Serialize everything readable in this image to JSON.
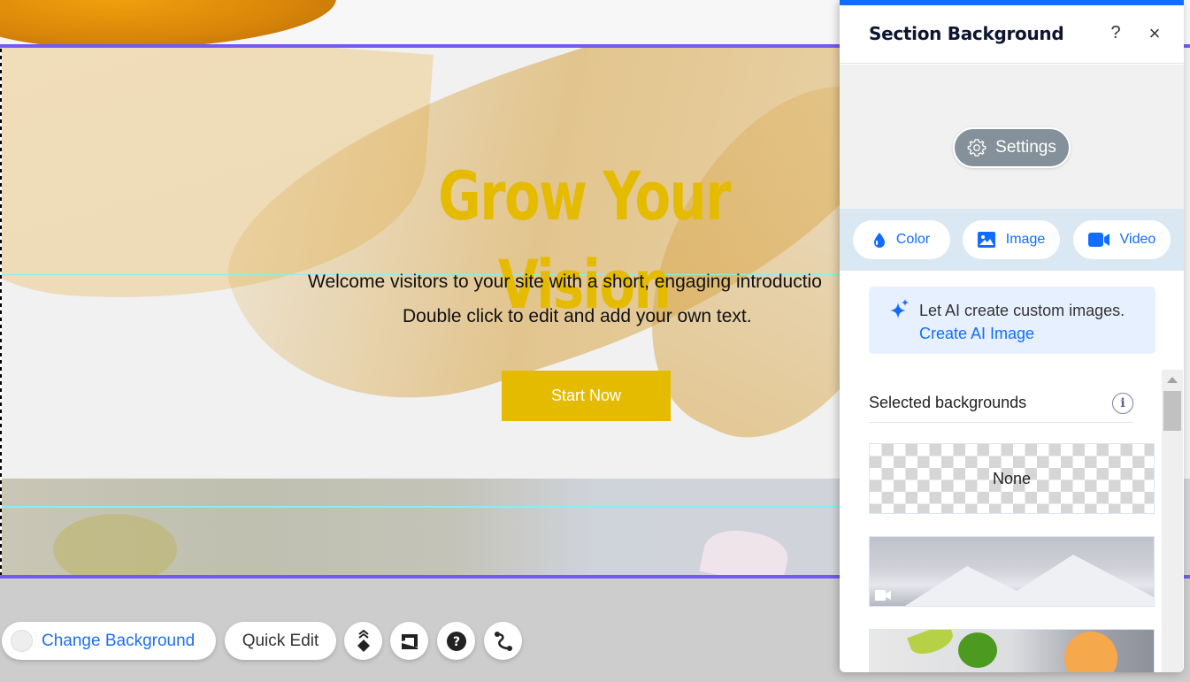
{
  "site": {
    "headline": "Grow Your Vision",
    "intro_line1": "Welcome visitors to your site with a short, engaging introductio",
    "intro_line2": "Double click to edit and add your own text.",
    "cta_button": "Start Now"
  },
  "toolbar": {
    "change_background": "Change Background",
    "quick_edit": "Quick Edit",
    "icons": [
      "arrange-icon",
      "stretch-icon",
      "help-icon",
      "animation-path-icon"
    ]
  },
  "panel": {
    "title": "Section Background",
    "help": "?",
    "close": "×",
    "settings_button": "Settings",
    "type_buttons": [
      {
        "label": "Color",
        "icon": "drop-icon"
      },
      {
        "label": "Image",
        "icon": "image-icon"
      },
      {
        "label": "Video",
        "icon": "video-icon"
      }
    ],
    "ai_prompt": {
      "text": "Let AI create custom images.",
      "link": "Create AI Image"
    },
    "selected_backgrounds_label": "Selected backgrounds",
    "info": "i",
    "backgrounds": [
      {
        "label": "None",
        "kind": "transparent"
      },
      {
        "label": "",
        "kind": "video"
      },
      {
        "label": "",
        "kind": "image"
      }
    ]
  },
  "colors": {
    "accent_blue": "#116dff",
    "section_outline": "#745af2",
    "guide_cyan": "#7ff2f5",
    "headline_gold": "#e5bb00",
    "settings_gray": "#84919a"
  }
}
